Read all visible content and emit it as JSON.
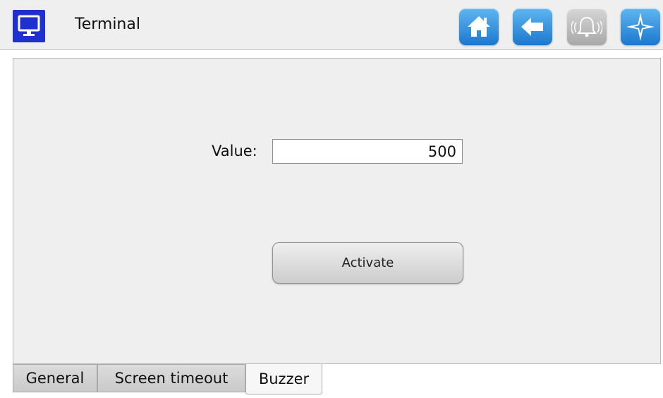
{
  "header": {
    "title": "Terminal",
    "app_icon": "monitor-icon",
    "buttons": [
      {
        "name": "home-button",
        "icon": "home-icon",
        "enabled": true
      },
      {
        "name": "back-button",
        "icon": "back-arrow-icon",
        "enabled": true
      },
      {
        "name": "alarm-button",
        "icon": "bell-icon",
        "enabled": false
      },
      {
        "name": "navigation-button",
        "icon": "compass-star-icon",
        "enabled": true
      }
    ]
  },
  "main": {
    "value_label": "Value:",
    "value": "500",
    "activate_label": "Activate"
  },
  "tabs": [
    {
      "label": "General",
      "active": false
    },
    {
      "label": "Screen timeout",
      "active": false
    },
    {
      "label": "Buzzer",
      "active": true
    }
  ],
  "colors": {
    "app_icon_bg": "#1f2fd0",
    "header_button_blue": "#2f8fdc",
    "header_button_disabled": "#b8b8b8",
    "panel_bg": "#efefef"
  }
}
